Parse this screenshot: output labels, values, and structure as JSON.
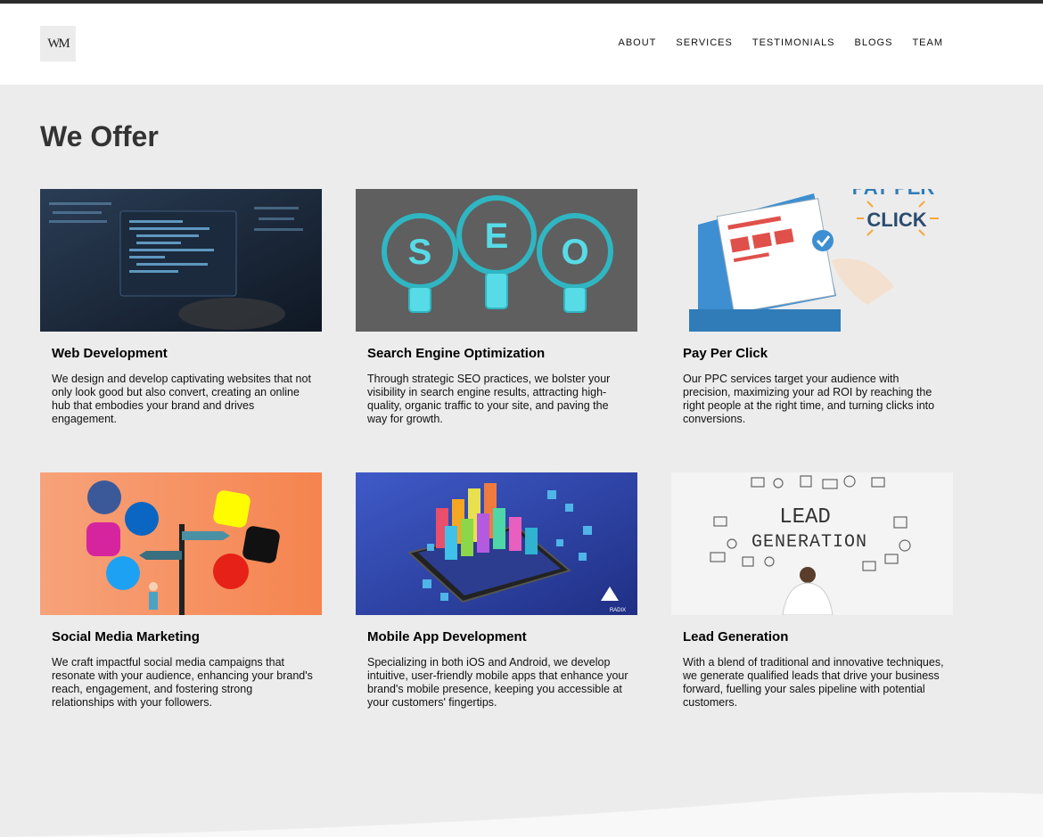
{
  "header": {
    "logo_text": "WM",
    "nav": [
      "ABOUT",
      "SERVICES",
      "TESTIMONIALS",
      "BLOGS",
      "TEAM"
    ]
  },
  "main": {
    "title": "We Offer",
    "services": [
      {
        "title": "Web Development",
        "desc": "We design and develop captivating websites that not only look good but also convert, creating an online hub that embodies your brand and drives engagement."
      },
      {
        "title": "Search Engine Optimization",
        "desc": "Through strategic SEO practices, we bolster your visibility in search engine results, attracting high-quality, organic traffic to your site, and paving the way for growth."
      },
      {
        "title": "Pay Per Click",
        "desc": "Our PPC services target your audience with precision, maximizing your ad ROI by reaching the right people at the right time, and turning clicks into conversions."
      },
      {
        "title": "Social Media Marketing",
        "desc": "We craft impactful social media campaigns that resonate with your audience, enhancing your brand's reach, engagement, and fostering strong relationships with your followers."
      },
      {
        "title": "Mobile App Development",
        "desc": "Specializing in both iOS and Android, we develop intuitive, user-friendly mobile apps that enhance your brand's mobile presence, keeping you accessible at your customers' fingertips."
      },
      {
        "title": "Lead Generation",
        "desc": "With a blend of traditional and innovative techniques, we generate qualified leads that drive your business forward, fuelling your sales pipeline with potential customers."
      }
    ],
    "image_text": {
      "seo": [
        "S",
        "E",
        "O"
      ],
      "ppc_top": "PAY PER",
      "ppc_bottom": "CLICK",
      "lead_line1": "LEAD",
      "lead_line2": "GENERATION",
      "app_brand": "RADIX"
    }
  }
}
